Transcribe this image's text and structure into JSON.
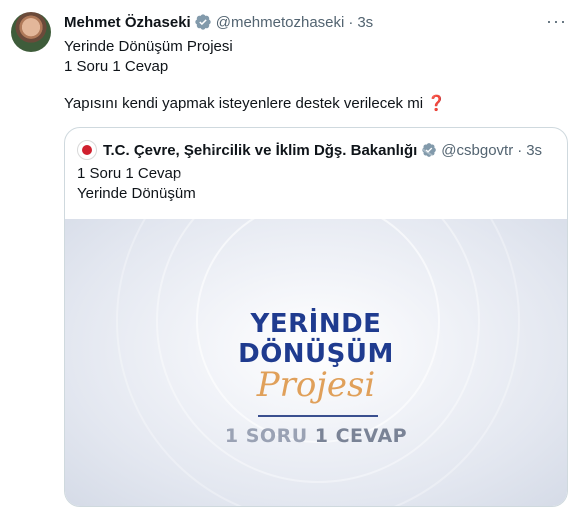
{
  "tweet": {
    "author_name": "Mehmet Özhaseki",
    "author_handle": "@mehmetozhaseki",
    "separator": "·",
    "time": "3s",
    "more_icon": "···",
    "lines": [
      "Yerinde Dönüşüm Projesi",
      "1 Soru 1 Cevap"
    ],
    "question": "Yapısını kendi yapmak isteyenlere destek verilecek mi",
    "question_emoji": "❓"
  },
  "quote": {
    "author_name": "T.C. Çevre, Şehircilik ve İklim Dğş. Bakanlığı",
    "author_handle": "@csbgovtr",
    "separator": "·",
    "time": "3s",
    "lines": [
      "1 Soru 1 Cevap",
      "Yerinde Dönüşüm"
    ],
    "media": {
      "title_line1": "YERİNDE",
      "title_line2": "DÖNÜŞÜM",
      "script": "Projesi",
      "sub_a": "1 SORU ",
      "sub_b": "1 CEVAP"
    }
  },
  "colors": {
    "verified": "#829aab",
    "accent_blue": "#1f3b8f",
    "accent_orange": "#e0a05a",
    "secondary_text": "#536471"
  }
}
